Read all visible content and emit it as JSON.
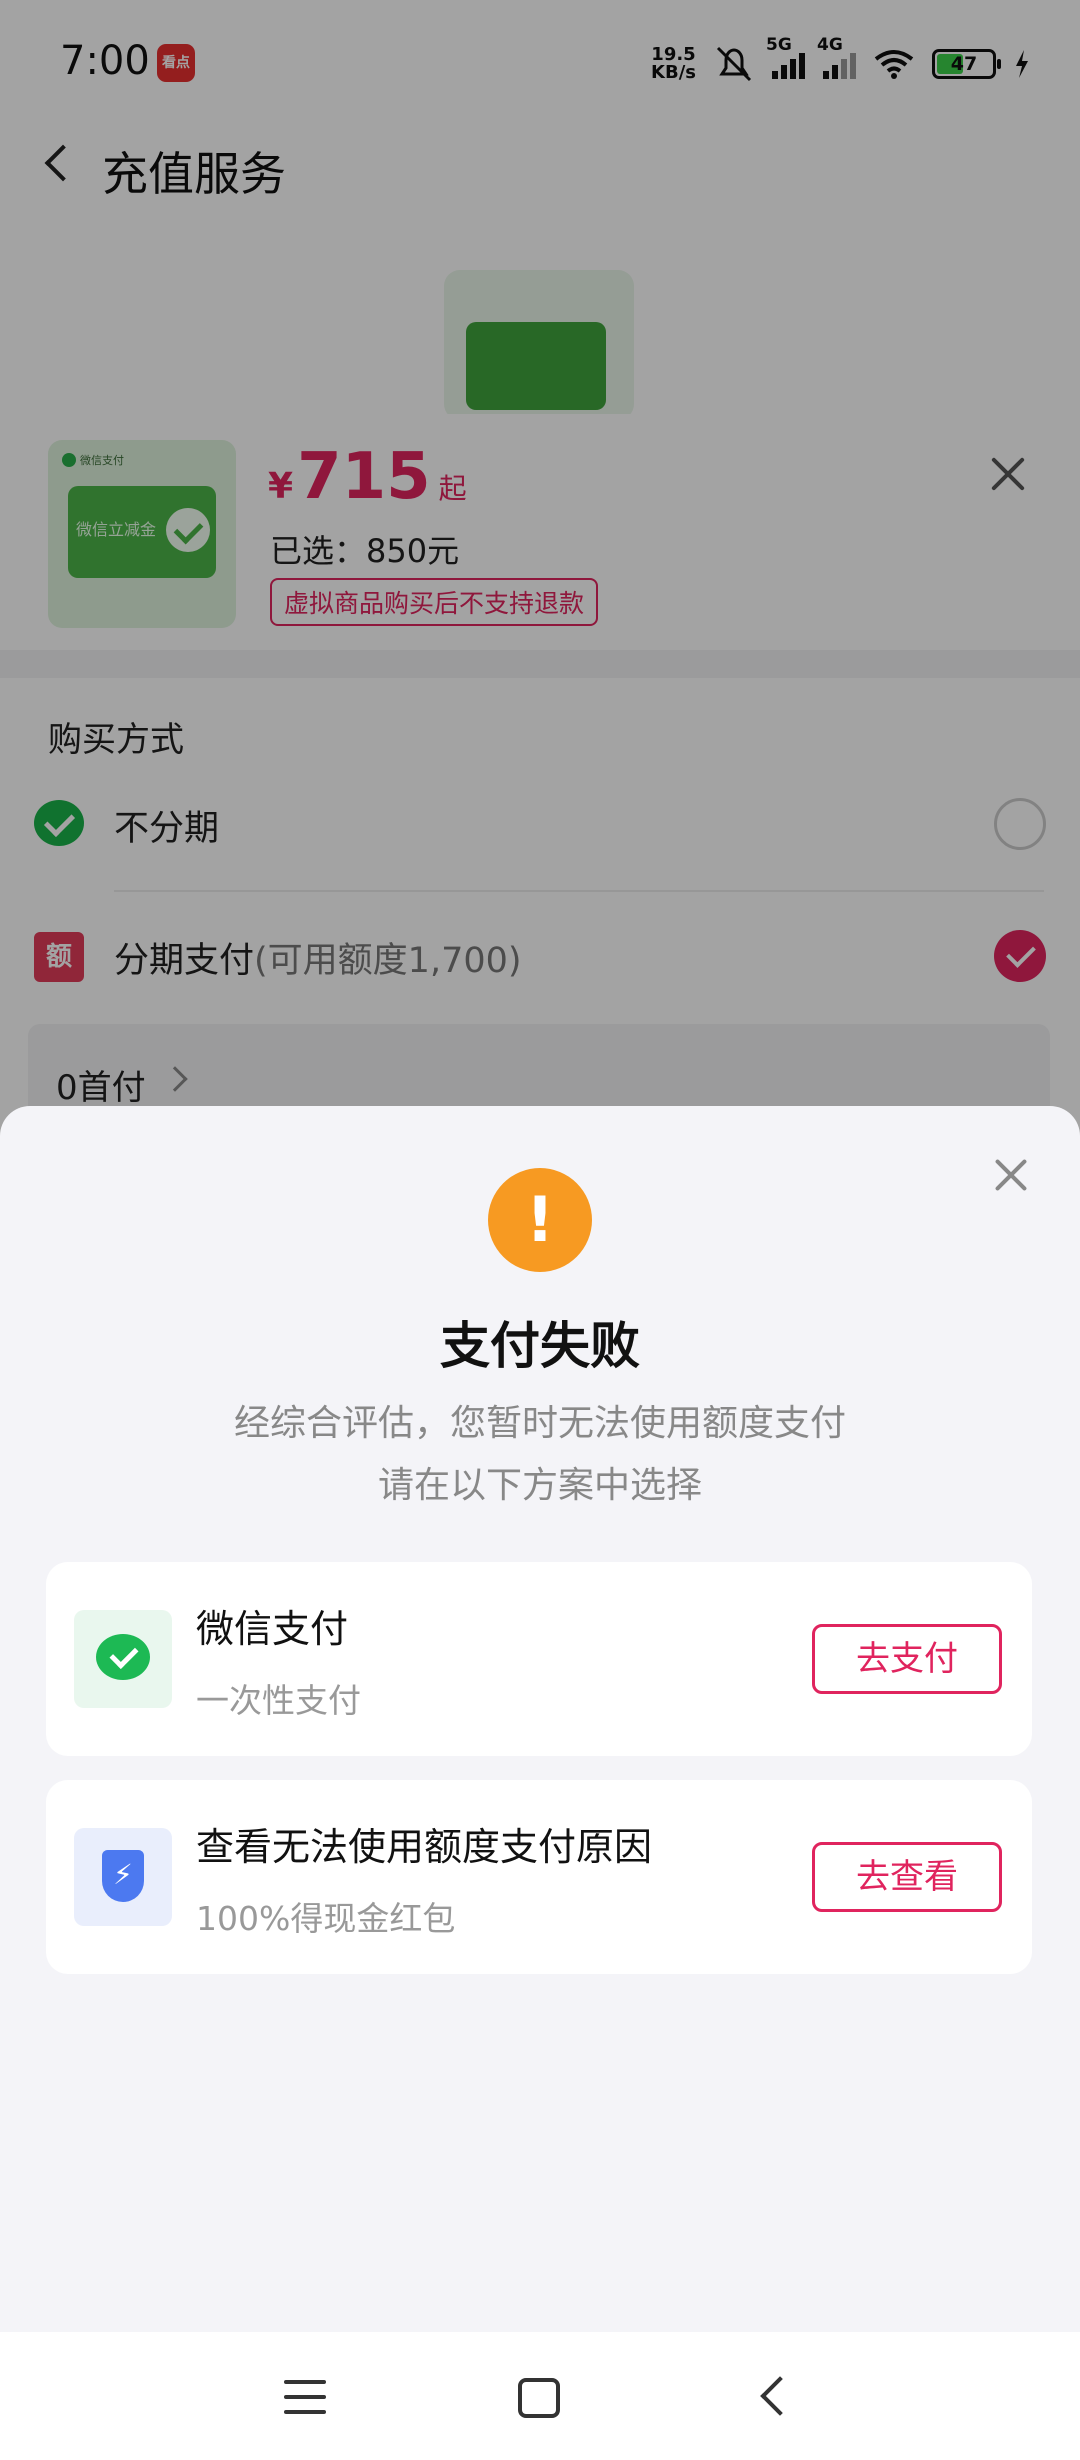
{
  "status_bar": {
    "time": "7:00",
    "app_icon_text": "看点",
    "net_speed_value": "19.5",
    "net_speed_unit": "KB/s",
    "sig1_label": "5G",
    "sig2_label": "4G",
    "battery_level": "47",
    "icons": [
      "bell-muted-icon",
      "signal-icon",
      "wifi-icon",
      "battery-icon",
      "charging-icon"
    ]
  },
  "header": {
    "title": "充值服务"
  },
  "product": {
    "badge": "微信支付",
    "card_text": "微信立减金",
    "price_symbol": "¥",
    "price": "715",
    "price_suffix": "起",
    "selected": "已选：850元",
    "refund_notice": "虚拟商品购买后不支持退款"
  },
  "purchase": {
    "section_title": "购买方式",
    "option_no_installment": "不分期",
    "option_installment": "分期支付",
    "option_installment_sub": "(可用额度1,700)",
    "installment_icon_text": "额",
    "installment_selected": true,
    "down_payment": "0首付"
  },
  "failure_dialog": {
    "icon_glyph": "!",
    "title": "支付失败",
    "desc_line1": "经综合评估，您暂时无法使用额度支付",
    "desc_line2": "请在以下方案中选择",
    "options": [
      {
        "title": "微信支付",
        "subtitle": "一次性支付",
        "button": "去支付"
      },
      {
        "title": "查看无法使用额度支付原因",
        "subtitle": "100%得现金红包",
        "button": "去查看"
      }
    ]
  },
  "colors": {
    "accent": "#e0245e",
    "warning": "#f79a22",
    "wechat_green": "#1db954",
    "shield_blue": "#4c79f0"
  }
}
